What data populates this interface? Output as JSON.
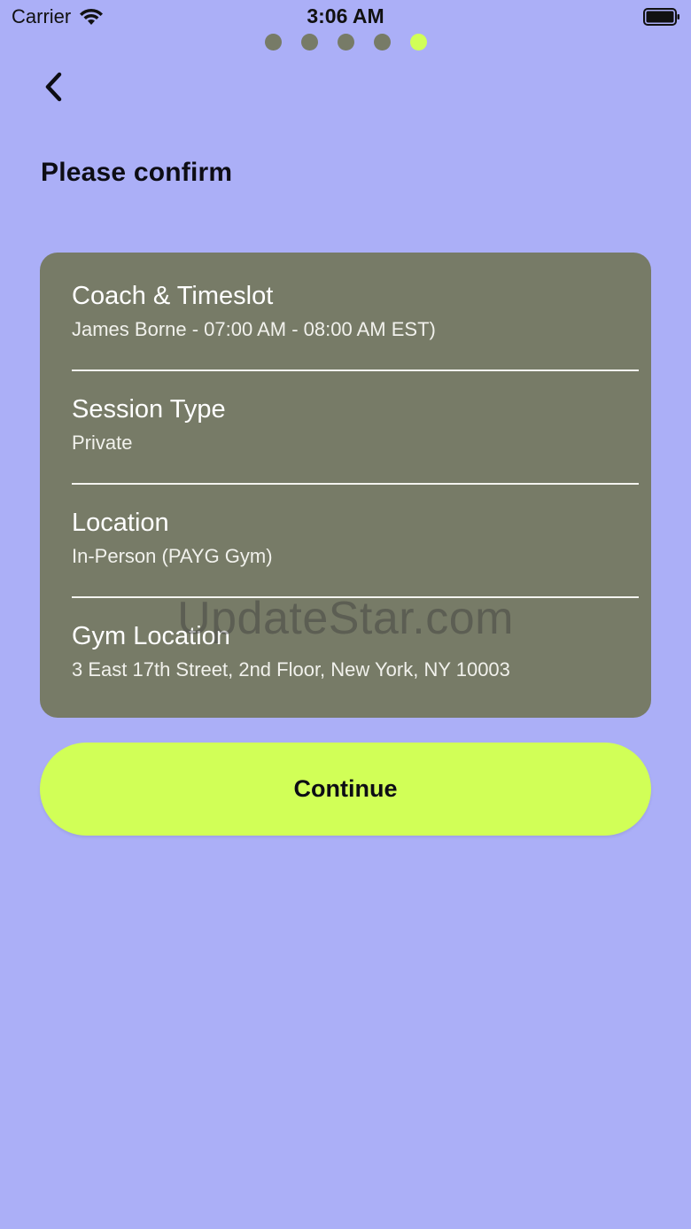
{
  "status_bar": {
    "carrier": "Carrier",
    "time": "3:06 AM"
  },
  "progress": {
    "total_steps": 5,
    "current_step": 5,
    "inactive_color": "#777b67",
    "active_color": "#d1ff57"
  },
  "header": {
    "back_icon": "chevron-left-icon",
    "title": "Please confirm"
  },
  "summary": {
    "items": [
      {
        "label": "Coach & Timeslot",
        "value": "James Borne - 07:00 AM - 08:00 AM EST)"
      },
      {
        "label": "Session Type",
        "value": "Private"
      },
      {
        "label": "Location",
        "value": "In-Person (PAYG Gym)"
      },
      {
        "label": "Gym Location",
        "value": "3 East 17th Street, 2nd Floor, New York, NY 10003"
      }
    ]
  },
  "watermark": "UpdateStar.com",
  "actions": {
    "continue_label": "Continue"
  },
  "colors": {
    "background": "#abaff7",
    "card": "#777b67",
    "accent": "#d1ff57"
  }
}
